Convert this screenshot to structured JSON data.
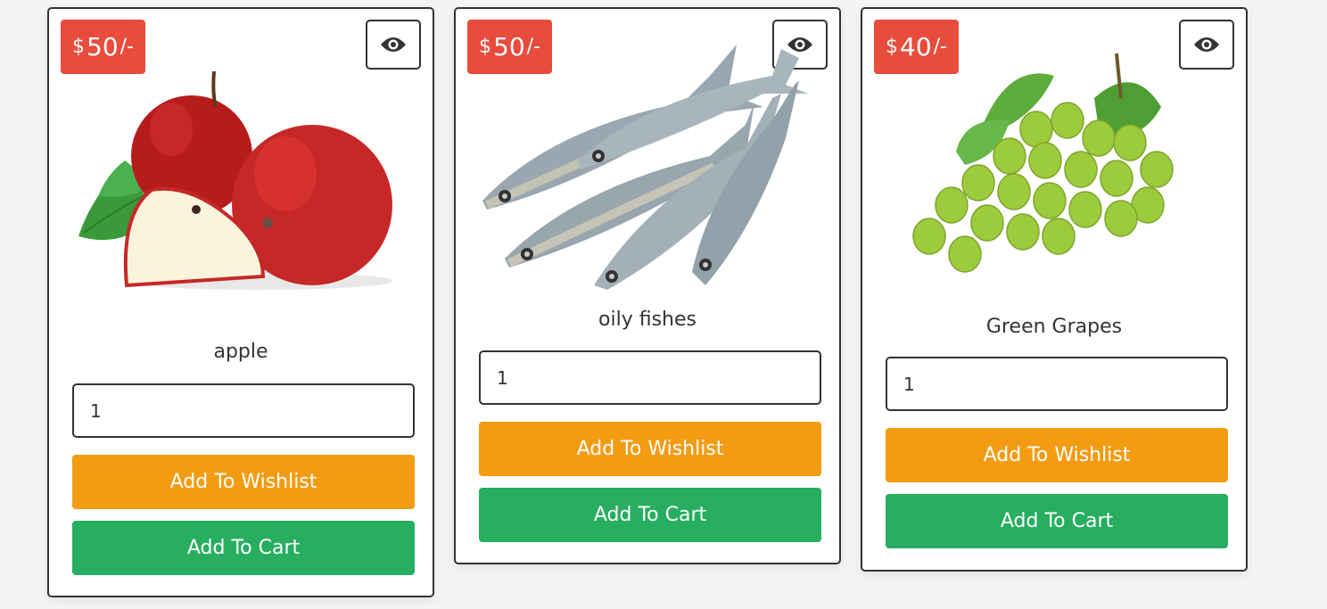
{
  "products": [
    {
      "name": "apple",
      "currency": "$",
      "price": "50",
      "suffix": "/-",
      "quantity": "1",
      "wishlist_label": "Add To Wishlist",
      "cart_label": "Add To Cart"
    },
    {
      "name": "oily fishes",
      "currency": "$",
      "price": "50",
      "suffix": "/-",
      "quantity": "1",
      "wishlist_label": "Add To Wishlist",
      "cart_label": "Add To Cart"
    },
    {
      "name": "Green Grapes",
      "currency": "$",
      "price": "40",
      "suffix": "/-",
      "quantity": "1",
      "wishlist_label": "Add To Wishlist",
      "cart_label": "Add To Cart"
    }
  ],
  "icons": {
    "view": "eye-icon"
  },
  "colors": {
    "price_badge": "#e74c3c",
    "wishlist": "#f39c12",
    "cart": "#27ae60",
    "border": "#333333"
  }
}
